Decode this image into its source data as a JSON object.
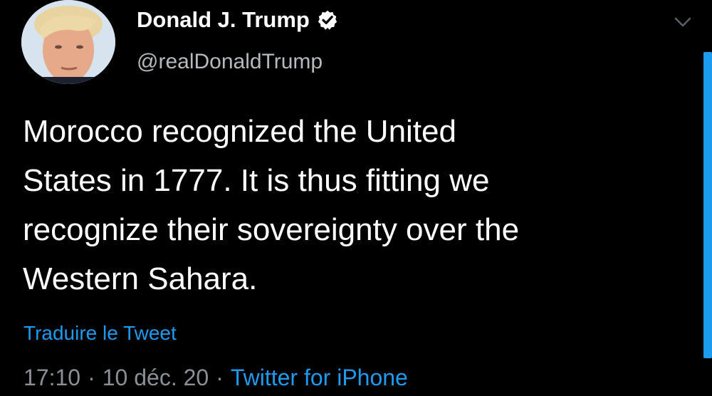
{
  "author": {
    "display_name": "Donald J. Trump",
    "handle": "@realDonaldTrump",
    "verified": true,
    "avatar_icon": "profile-photo"
  },
  "tweet": {
    "text": "Morocco recognized the United\nStates in 1777.  It is thus fitting we\nrecognize their sovereignty over the\nWestern Sahara.",
    "translate_label": "Traduire le Tweet"
  },
  "meta": {
    "time": "17:10",
    "date": "10 déc. 20",
    "separator": "·",
    "source": "Twitter for iPhone"
  },
  "icons": {
    "menu": "chevron-down-icon",
    "verified": "verified-badge-icon"
  },
  "colors": {
    "background": "#000000",
    "text": "#ffffff",
    "secondary_text": "#b6b9bd",
    "accent": "#1d9bf0"
  }
}
